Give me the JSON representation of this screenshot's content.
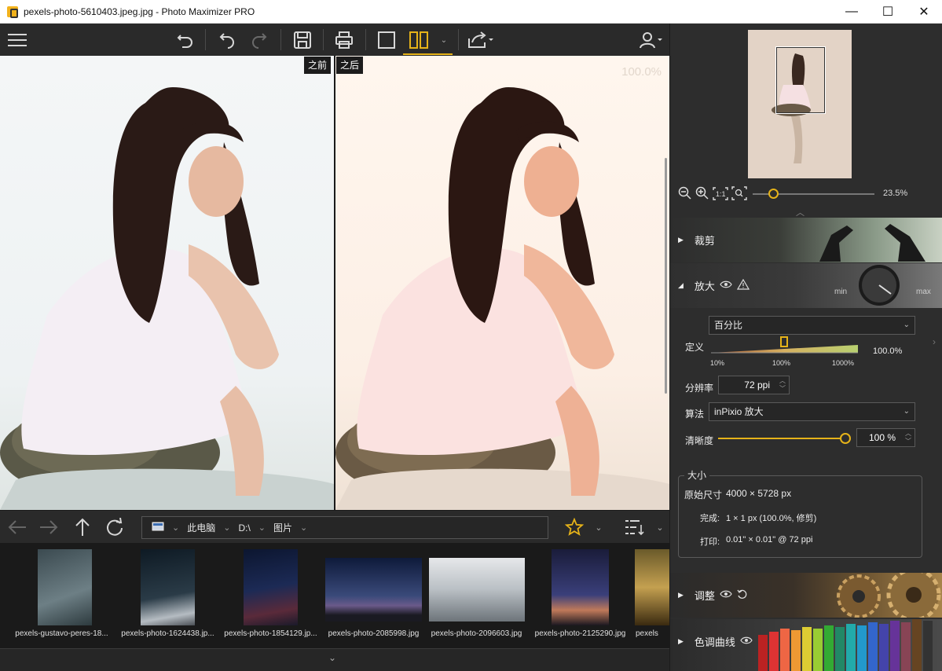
{
  "window": {
    "title": "pexels-photo-5610403.jpeg.jpg - Photo Maximizer PRO",
    "minimize": "—",
    "maximize": "☐",
    "close": "✕"
  },
  "viewer": {
    "before_label": "之前",
    "after_label": "之后",
    "zoom_overlay": "100.0%"
  },
  "nav": {
    "path": [
      "此电脑",
      "D:\\",
      "图片"
    ]
  },
  "thumbnails": [
    {
      "caption": "pexels-gustavo-peres-18..."
    },
    {
      "caption": "pexels-photo-1624438.jp..."
    },
    {
      "caption": "pexels-photo-1854129.jp..."
    },
    {
      "caption": "pexels-photo-2085998.jpg"
    },
    {
      "caption": "pexels-photo-2096603.jpg"
    },
    {
      "caption": "pexels-photo-2125290.jpg"
    },
    {
      "caption": "pexels"
    }
  ],
  "panel": {
    "zoom_value": "23.5%",
    "sections": {
      "crop": "裁剪",
      "enlarge": "放大",
      "enlarge_min": "min",
      "enlarge_max": "max",
      "adjust": "调整",
      "tone_curve": "色调曲线"
    },
    "enlarge": {
      "mode": "百分比",
      "definition_label": "定义",
      "definition_value": "100.0%",
      "definition_level": 0.5,
      "scale_ticks": [
        "10%",
        "100%",
        "1000%"
      ],
      "resolution_label": "分辨率",
      "resolution_value": "72 ppi",
      "algorithm_label": "算法",
      "algorithm_value": "inPixio 放大",
      "sharpness_label": "清晰度",
      "sharpness_value": "100 %",
      "sharpness_level": 1.0
    },
    "size": {
      "title": "大小",
      "original_label": "原始尺寸",
      "original_value": "4000 × 5728 px",
      "done_label": "完成:",
      "done_value": "1 × 1 px (100.0%, 修剪)",
      "print_label": "打印:",
      "print_value": "0.01\" × 0.01\" @ 72 ppi"
    }
  },
  "colors": {
    "accent": "#e6b319",
    "background": "#2a2a2a",
    "panel": "#2d2d2d"
  }
}
